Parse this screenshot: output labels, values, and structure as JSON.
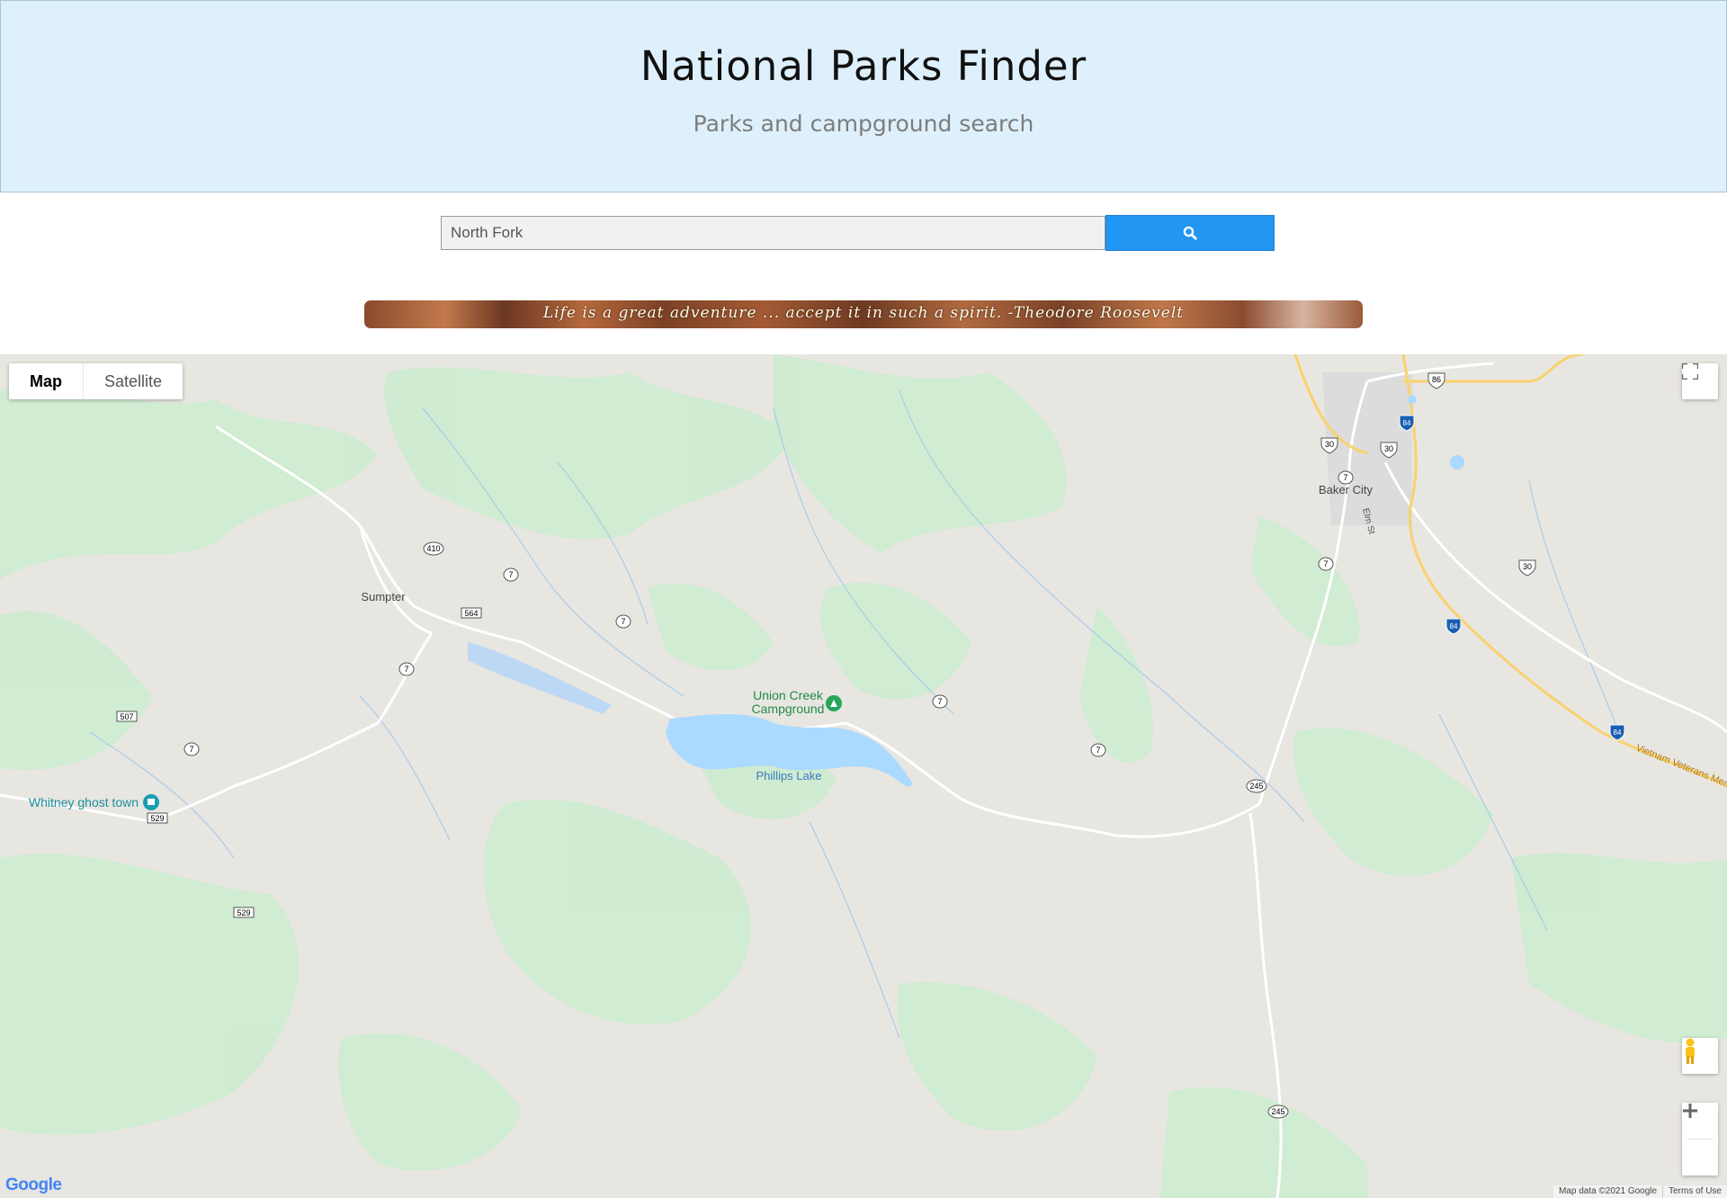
{
  "header": {
    "title": "National Parks Finder",
    "subtitle": "Parks and campground search"
  },
  "search": {
    "value": "North Fork",
    "button_icon": "search-icon"
  },
  "banner": {
    "quote": "Life is a great adventure ... accept it in such a spirit. -Theodore Roosevelt"
  },
  "map": {
    "type_controls": {
      "map_label": "Map",
      "satellite_label": "Satellite",
      "selected": "Map"
    },
    "places": {
      "baker_city": "Baker City",
      "sumpter": "Sumpter",
      "union_creek_line1": "Union Creek",
      "union_creek_line2": "Campground",
      "phillips_lake": "Phillips Lake",
      "whitney": "Whitney ghost town",
      "elm_st": "Elm St",
      "vietnam_memorial": "Vietnam Veterans Memor"
    },
    "shields": {
      "r7": "7",
      "r410": "410",
      "r564": "564",
      "r507": "507",
      "r529": "529",
      "r245": "245",
      "r30": "30",
      "r86": "86",
      "r84": "84"
    },
    "footer": {
      "attribution": "Map data ©2021 Google",
      "terms": "Terms of Use"
    },
    "logo": "Google",
    "colors": {
      "land": "#e8e6e1",
      "park": "#cdecd0",
      "water": "#aadaff",
      "highway": "#f9d26e",
      "road": "#ffffff",
      "interstate": "#1a5fb4"
    }
  }
}
